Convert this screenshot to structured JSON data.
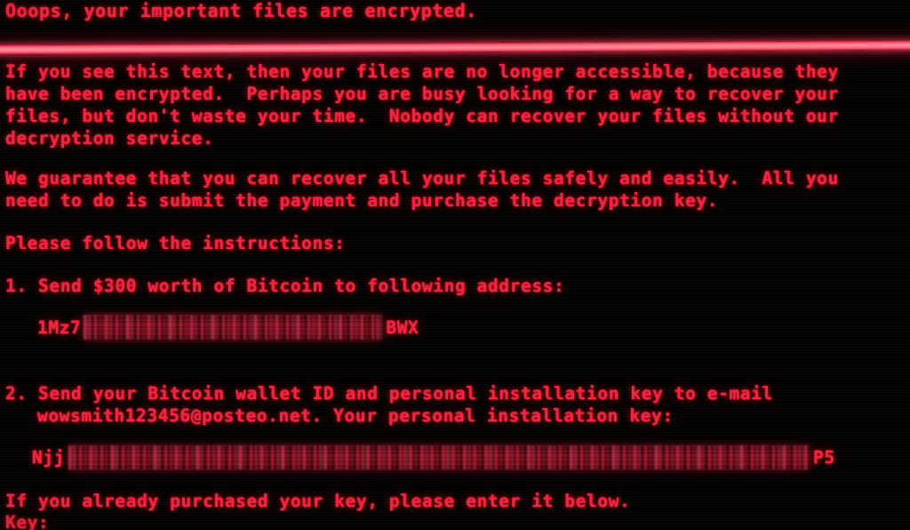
{
  "screen": {
    "title": "Ooops, your important files are encrypted.",
    "background_color": "#030001",
    "text_color": "#f8213c",
    "separator_color": "#ff8e9d"
  },
  "intro": {
    "lines": [
      "If you see this text, then your files are no longer accessible, because they",
      "have been encrypted.  Perhaps you are busy looking for a way to recover your",
      "files, but don't waste your time.  Nobody can recover your files without our",
      "decryption service."
    ]
  },
  "guarantee": {
    "lines": [
      "We guarantee that you can recover all your files safely and easily.  All you",
      "need to do is submit the payment and purchase the decryption key."
    ]
  },
  "instructions_heading": "Please follow the instructions:",
  "item1": {
    "text": "1. Send $300 worth of Bitcoin to following address:",
    "amount": "$300",
    "currency": "Bitcoin",
    "bitcoin_address": {
      "prefix": "1Mz7",
      "redacted": "redacted-blur",
      "suffix": "BWX"
    }
  },
  "item2": {
    "lines": [
      "2. Send your Bitcoin wallet ID and personal installation key to e-mail",
      "wowsmith123456@posteo.net. Your personal installation key:"
    ],
    "email": "wowsmith123456@posteo.net",
    "installation_key": {
      "prefix": "Njj",
      "redacted": "redacted-blur",
      "suffix": "P5"
    }
  },
  "footer": {
    "note": "If you already purchased your key, please enter it below.",
    "key_label": "Key:",
    "key_value": ""
  }
}
